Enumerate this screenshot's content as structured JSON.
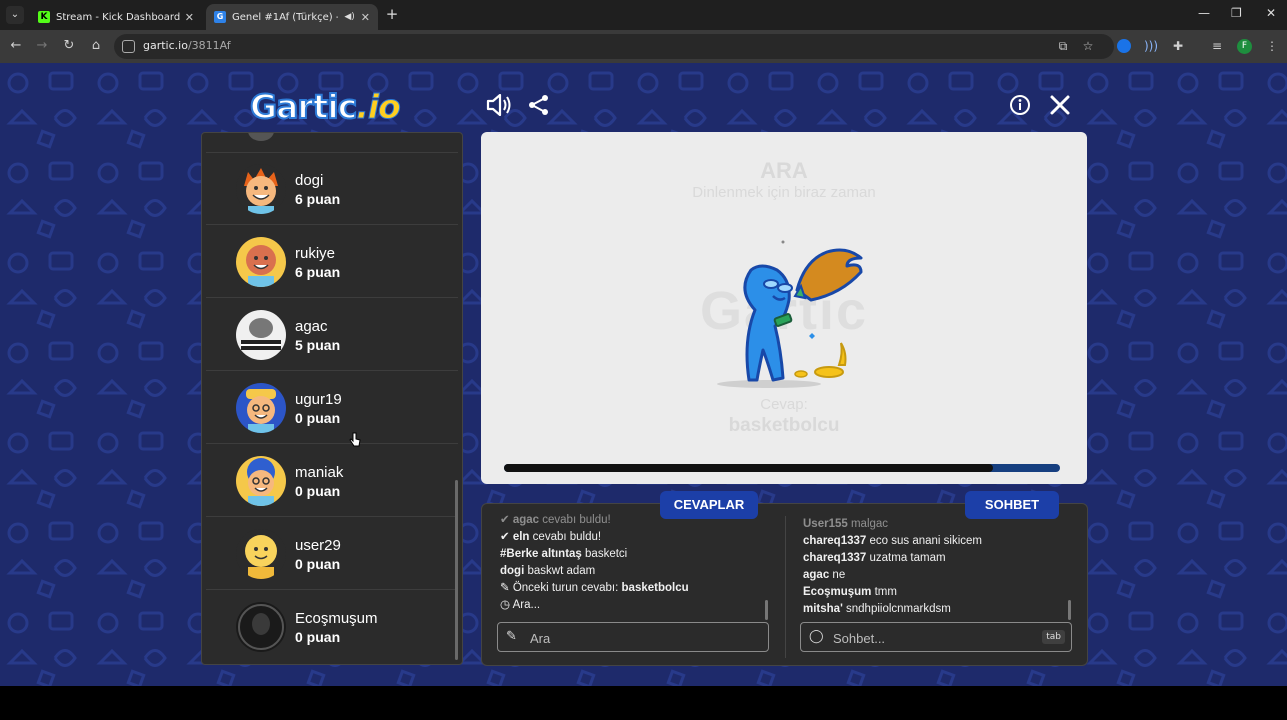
{
  "browser": {
    "tabs": [
      {
        "title": "Stream - Kick Dashboard",
        "favicon": "kick-icon"
      },
      {
        "title": "Genel #1Af (Türkçe) - Gartic",
        "favicon": "gartic-icon"
      }
    ],
    "url_host": "gartic.io",
    "url_path": "/3811Af",
    "profile_initial": "F"
  },
  "game": {
    "logo_main": "Gartic",
    "logo_suffix": ".io",
    "players": [
      {
        "name": "dogi",
        "points": "6 puan",
        "avatar": "orange-hair-avatar"
      },
      {
        "name": "rukiye",
        "points": "6 puan",
        "avatar": "red-face-avatar"
      },
      {
        "name": "agac",
        "points": "5 puan",
        "avatar": "photo-avatar"
      },
      {
        "name": "ugur19",
        "points": "0 puan",
        "avatar": "yellow-cap-avatar"
      },
      {
        "name": "maniak",
        "points": "0 puan",
        "avatar": "blue-hair-avatar"
      },
      {
        "name": "user29",
        "points": "0 puan",
        "avatar": "yellow-avatar"
      },
      {
        "name": "Ecoşmuşum",
        "points": "0 puan",
        "avatar": "dark-photo-avatar"
      }
    ],
    "canvas": {
      "status_title": "ARA",
      "status_subtitle": "Dinlenmek için biraz zaman",
      "answer_label": "Cevap:",
      "answer_value": "basketbolcu",
      "timer_progress": 0.88
    },
    "answers_tab": "CEVAPLAR",
    "chat_tab": "SOHBET",
    "answers": [
      {
        "user": "agac",
        "text": "cevabı buldu!",
        "icon": "check-icon",
        "faint": true
      },
      {
        "user": "eln",
        "text": "cevabı buldu!",
        "icon": "check-icon",
        "faint": false
      },
      {
        "user": "#Berke altıntaş",
        "text": "basketci",
        "icon": "",
        "faint": false
      },
      {
        "user": "dogi",
        "text": "baskwt adam",
        "icon": "",
        "faint": false
      }
    ],
    "prev_answer_label": "Önceki turun cevabı:",
    "prev_answer_value": "basketbolcu",
    "waiting_label": "Ara...",
    "chat": [
      {
        "user": "User155",
        "text": "malgac",
        "faint": true
      },
      {
        "user": "chareq1337",
        "text": "eco sus anani sikicem",
        "faint": false
      },
      {
        "user": "chareq1337",
        "text": "uzatma tamam",
        "faint": false
      },
      {
        "user": "agac",
        "text": "ne",
        "faint": false
      },
      {
        "user": "Ecoşmuşum",
        "text": "tmm",
        "faint": false
      },
      {
        "user": "mitsha'",
        "text": "sndhpiiolcnmarkdsm",
        "faint": false
      }
    ],
    "answer_input_placeholder": "Ara",
    "chat_input_placeholder": "Sohbet...",
    "tab_hint": "tab"
  }
}
